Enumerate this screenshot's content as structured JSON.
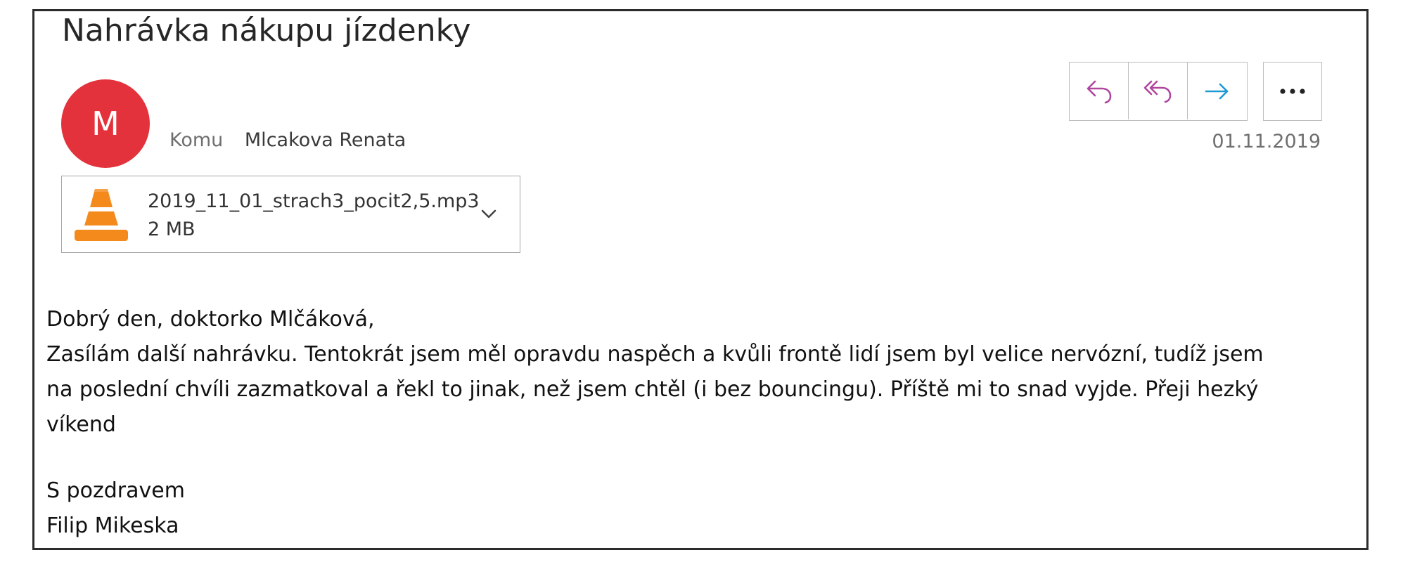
{
  "email": {
    "subject": "Nahrávka nákupu jízdenky",
    "avatar_letter": "M",
    "avatar_color": "#e3323b",
    "to_label": "Komu",
    "to_name": "Mlcakova Renata",
    "date": "01.11.2019",
    "actions": {
      "reply_icon": "reply-icon",
      "reply_all_icon": "reply-all-icon",
      "forward_icon": "forward-icon",
      "more_icon": "more-icon",
      "reply_color": "#b0479e",
      "forward_color": "#1f9bd1"
    },
    "attachment": {
      "icon": "vlc-cone-icon",
      "file_name": "2019_11_01_strach3_pocit2,5.mp3",
      "file_size": "2 MB"
    },
    "body": {
      "greeting": "Dobrý den, doktorko Mlčáková,",
      "line1": "Zasílám další nahrávku. Tentokrát jsem měl opravdu naspěch a kvůli frontě lidí jsem byl velice nervózní, tudíž jsem",
      "line2": "na poslední chvíli zazmatkoval a řekl to jinak, než jsem chtěl (i bez bouncingu). Příště mi to snad vyjde. Přeji hezký",
      "line3": "víkend",
      "closing": "S pozdravem",
      "signature": "Filip Mikeska"
    }
  }
}
